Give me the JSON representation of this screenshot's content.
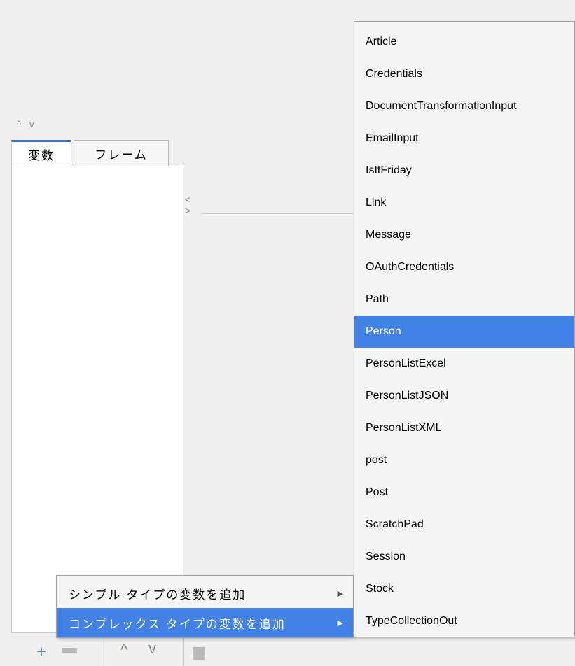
{
  "window": {
    "collapse_up": "^",
    "collapse_down": "v"
  },
  "tabs": [
    {
      "label": "変数",
      "active": true
    },
    {
      "label": "フレーム",
      "active": false
    }
  ],
  "splitter": {
    "left": "<",
    "right": ">"
  },
  "toolbar": {
    "add": "+",
    "up": "^",
    "down": "v"
  },
  "context_menu": {
    "items": [
      {
        "label": "シンプル タイプの変数を追加",
        "arrow": "▶"
      },
      {
        "label": "コンプレックス タイプの変数を追加",
        "arrow": "▶",
        "selected": true
      }
    ]
  },
  "type_submenu": {
    "items": [
      "Article",
      "Credentials",
      "DocumentTransformationInput",
      "EmailInput",
      "IsItFriday",
      "Link",
      "Message",
      "OAuthCredentials",
      "Path",
      "Person",
      "PersonListExcel",
      "PersonListJSON",
      "PersonListXML",
      "post",
      "Post",
      "ScratchPad",
      "Session",
      "Stock",
      "TypeCollectionOut"
    ],
    "selected": "Person"
  },
  "colors": {
    "accent": "#4281e6",
    "tab_accent": "#3c6fb4"
  }
}
